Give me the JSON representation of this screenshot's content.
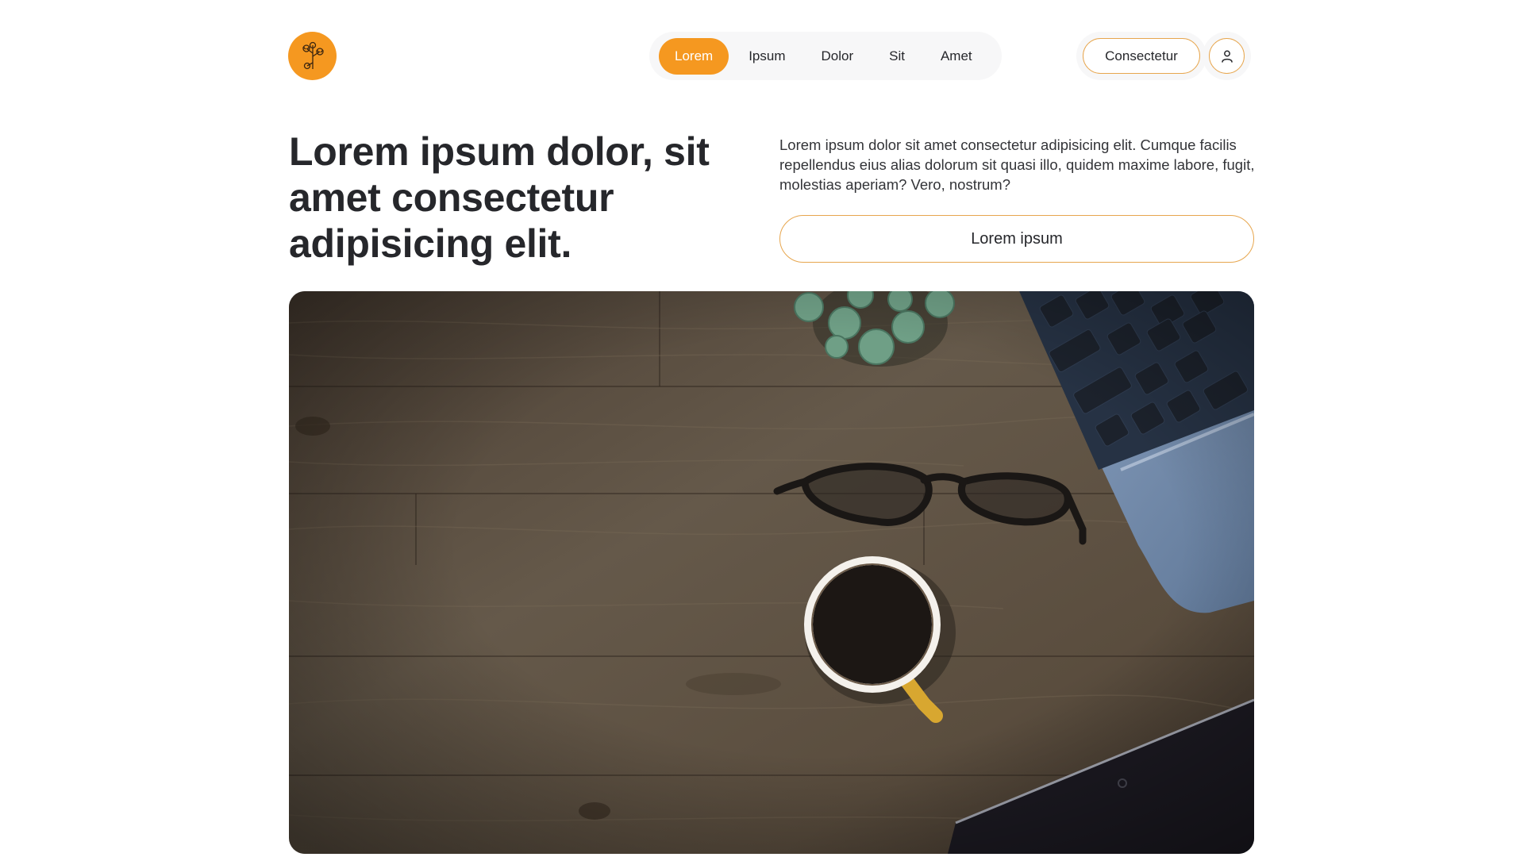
{
  "header": {
    "logo_icon": "flower-icon",
    "nav": [
      {
        "label": "Lorem",
        "active": true
      },
      {
        "label": "Ipsum",
        "active": false
      },
      {
        "label": "Dolor",
        "active": false
      },
      {
        "label": "Sit",
        "active": false
      },
      {
        "label": "Amet",
        "active": false
      }
    ],
    "cta_label": "Consectetur",
    "user_icon": "user-icon"
  },
  "hero": {
    "headline": "Lorem ipsum dolor, sit amet consectetur adipisicing elit.",
    "lead": "Lorem ipsum dolor sit amet consectetur adipisicing elit. Cumque facilis repellendus eius alias dolorum sit quasi illo, quidem maxime labore, fugit, molestias aperiam? Vero, nostrum?",
    "button_label": "Lorem ipsum",
    "image_subject": "desk-workspace-photo"
  },
  "colors": {
    "accent": "#f59820",
    "outline": "#e7a64e",
    "text": "#26272b"
  }
}
